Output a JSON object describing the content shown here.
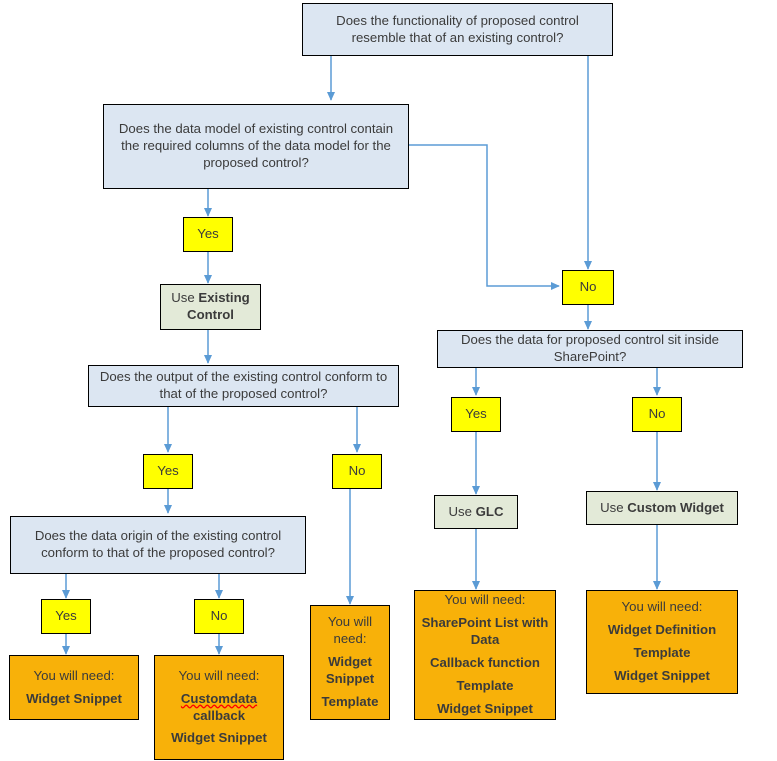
{
  "diagram": {
    "title": "Proposed control implementation decision flowchart",
    "colors": {
      "decision_fill": "#dce6f2",
      "choice_fill": "#ffff00",
      "action_fill": "#e3ead8",
      "outcome_fill": "#f8b109",
      "border": "#000000",
      "connector": "#5b9bd5",
      "text": "#3b3b3b",
      "spellcheck_underline": "#ff0000"
    },
    "nodes": {
      "q_functionality": "Does the functionality of proposed control resemble that of an existing control?",
      "q_data_model": "Does the data model of existing control contain the required columns of the data model for the proposed control?",
      "q_output": "Does the output of the existing control conform to that of the proposed control?",
      "q_data_origin": "Does the data origin of the existing control conform to that of the proposed control?",
      "q_sharepoint": "Does the data for proposed control sit inside SharePoint?",
      "choice_yes": "Yes",
      "choice_no": "No",
      "action_existing_prefix": "Use ",
      "action_existing_bold": "Existing Control",
      "action_glc_prefix": "Use ",
      "action_glc_bold": "GLC",
      "action_custom_prefix": "Use ",
      "action_custom_bold": "Custom Widget",
      "outcome_lead": "You will need:"
    },
    "outcomes": {
      "widget_snippet_only": {
        "lead": "You will need:",
        "items": [
          "Widget Snippet"
        ]
      },
      "customdata": {
        "lead": "You will need:",
        "items": [
          "Customdata callback",
          "Widget Snippet"
        ],
        "misspelled_word": "Customdata",
        "rest_of_first_item": " callback"
      },
      "widget_template": {
        "lead": "You will need:",
        "items": [
          "Widget Snippet",
          "Template"
        ]
      },
      "glc": {
        "lead": "You will need:",
        "items": [
          "SharePoint List with Data",
          "Callback function",
          "Template",
          "Widget Snippet"
        ]
      },
      "custom_widget": {
        "lead": "You will need:",
        "items": [
          "Widget Definition",
          "Template",
          "Widget Snippet"
        ]
      }
    }
  }
}
